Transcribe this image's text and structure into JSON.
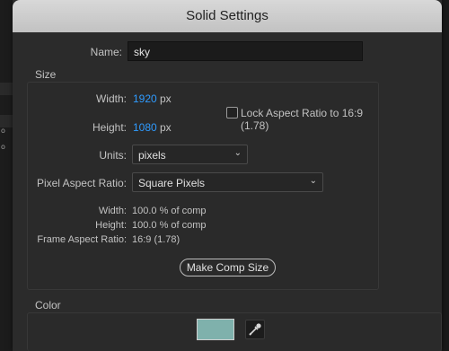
{
  "dialog": {
    "title": "Solid Settings"
  },
  "name": {
    "label": "Name:",
    "value": "sky"
  },
  "size": {
    "section_label": "Size",
    "width_label": "Width:",
    "width_value": "1920",
    "width_unit": "px",
    "height_label": "Height:",
    "height_value": "1080",
    "height_unit": "px",
    "lock_label": "Lock Aspect Ratio to 16:9 (1.78)",
    "lock_checked": false,
    "units_label": "Units:",
    "units_value": "pixels",
    "par_label": "Pixel Aspect Ratio:",
    "par_value": "Square Pixels",
    "info_width_label": "Width:",
    "info_width_value": "100.0 % of comp",
    "info_height_label": "Height:",
    "info_height_value": "100.0 % of comp",
    "info_far_label": "Frame Aspect Ratio:",
    "info_far_value": "16:9 (1.78)",
    "make_comp_size_label": "Make Comp Size"
  },
  "color": {
    "section_label": "Color",
    "swatch_hex": "#7fb1ac"
  },
  "colors": {
    "accent_blue": "#2f9bff",
    "dialog_bg": "#2b2b2b"
  },
  "icons": [
    "chevron-down-icon",
    "eyedropper-icon",
    "checkbox-icon"
  ]
}
